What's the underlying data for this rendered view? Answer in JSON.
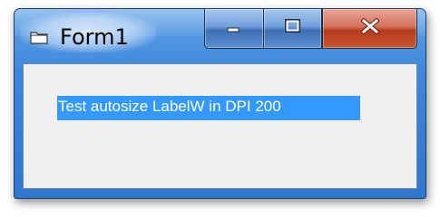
{
  "window": {
    "title": "Form1",
    "icon": "folder-icon",
    "buttons": {
      "minimize": "minimize-icon",
      "maximize": "maximize-icon",
      "close": "close-icon"
    }
  },
  "form": {
    "label_text": "Test autosize LabelW in DPI 200",
    "label_background": "#3399ff",
    "label_color": "#ffffff",
    "client_background": "#f0f0f0"
  }
}
